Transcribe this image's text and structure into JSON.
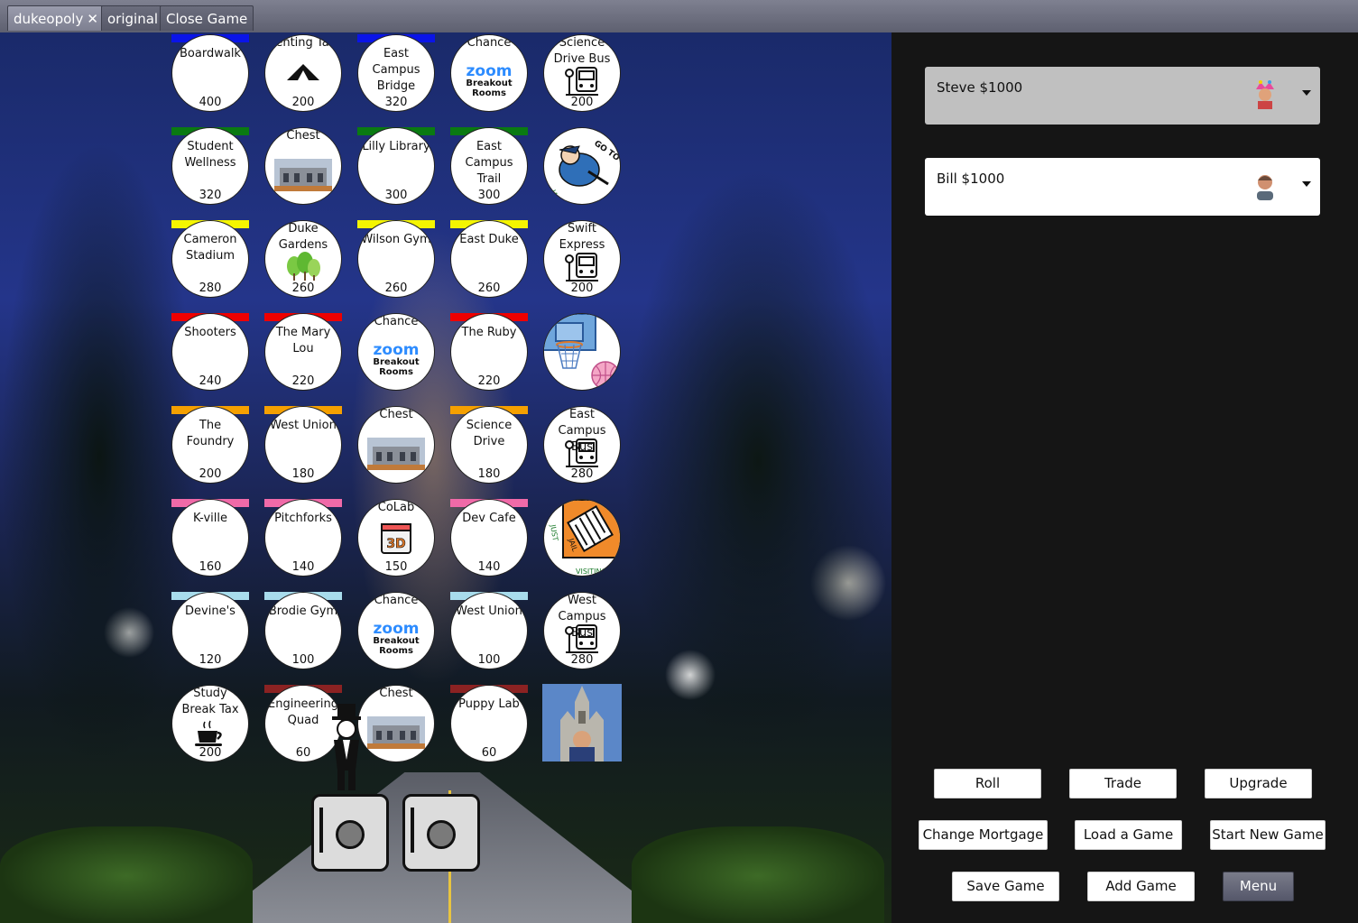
{
  "tabs": [
    {
      "label": "dukeopoly",
      "close": "✕"
    },
    {
      "label": "original"
    },
    {
      "label": "Close Game"
    }
  ],
  "board": {
    "row1": [
      {
        "name": "Boardwalk",
        "price": "400",
        "color": "#0a14e8"
      },
      {
        "name": "Tenting Tax",
        "price": "200",
        "icon": "tent-icon"
      },
      {
        "name": "East Campus Bridge",
        "price": "320",
        "color": "#0a14e8"
      },
      {
        "name": "Chance",
        "logo": "Zoom Breakout Rooms",
        "zoom1": "zoom",
        "zoom2": "Breakout",
        "zoom3": "Rooms"
      },
      {
        "name": "Science Drive Bus",
        "price": "200",
        "icon": "bus-stop-icon"
      }
    ],
    "row2": [
      {
        "name": "Student Wellness",
        "price": "320",
        "color": "#0a7a12"
      },
      {
        "name": "Chest",
        "icon": "building-photo-icon"
      },
      {
        "name": "Lilly Library",
        "price": "300",
        "color": "#0a7a12"
      },
      {
        "name": "East Campus Trail",
        "price": "300",
        "color": "#0a7a12"
      },
      {
        "name": "Go To Jail",
        "icon": "go-to-jail-icon",
        "caption1": "GO TO",
        "caption2": "JAIL"
      }
    ],
    "row3": [
      {
        "name": "Cameron Stadium",
        "price": "280",
        "color": "#f5f500"
      },
      {
        "name": "Duke Gardens",
        "price": "260",
        "icon": "trees-icon"
      },
      {
        "name": "Wilson Gym",
        "price": "260",
        "color": "#f5f500"
      },
      {
        "name": "East Duke",
        "price": "260",
        "color": "#f5f500"
      },
      {
        "name": "Swift Express",
        "price": "200",
        "icon": "bus-stop-icon"
      }
    ],
    "row4": [
      {
        "name": "Shooters",
        "price": "240",
        "color": "#ee0000"
      },
      {
        "name": "The Mary Lou",
        "price": "220",
        "color": "#ee0000"
      },
      {
        "name": "Chance",
        "zoom1": "zoom",
        "zoom2": "Breakout",
        "zoom3": "Rooms"
      },
      {
        "name": "The Ruby",
        "price": "220",
        "color": "#ee0000"
      },
      {
        "name": "Free Parking",
        "icon": "basketball-hoop-icon"
      }
    ],
    "row5": [
      {
        "name": "The Foundry",
        "price": "200",
        "color": "#f5a000"
      },
      {
        "name": "West Union",
        "price": "180",
        "color": "#f5a000"
      },
      {
        "name": "Chest",
        "icon": "building-photo-icon"
      },
      {
        "name": "Science Drive",
        "price": "180",
        "color": "#f5a000"
      },
      {
        "name": "East Campus Bus",
        "price": "280",
        "icon": "bus-stop-icon"
      }
    ],
    "row6": [
      {
        "name": "K-ville",
        "price": "160",
        "color": "#f06aa8"
      },
      {
        "name": "Pitchforks",
        "price": "140",
        "color": "#f06aa8"
      },
      {
        "name": "CoLab",
        "price": "150",
        "icon": "3d-printer-icon",
        "label3d": "3D"
      },
      {
        "name": "Dev Cafe",
        "price": "140",
        "color": "#f06aa8"
      },
      {
        "name": "Just Visiting",
        "icon": "jail-icon",
        "caption1": "JUST",
        "caption2": "VISITING",
        "caption3": "IN",
        "caption4": "JAIL"
      }
    ],
    "row7": [
      {
        "name": "Devine's",
        "price": "120",
        "color": "#a8dcec"
      },
      {
        "name": "Brodie Gym",
        "price": "100",
        "color": "#a8dcec"
      },
      {
        "name": "Chance",
        "zoom1": "zoom",
        "zoom2": "Breakout",
        "zoom3": "Rooms"
      },
      {
        "name": "West Union",
        "price": "100",
        "color": "#a8dcec"
      },
      {
        "name": "West Campus Bus",
        "price": "280",
        "icon": "bus-stop-icon"
      }
    ],
    "row8": [
      {
        "name": "Study Break Tax",
        "price": "200",
        "icon": "coffee-cup-icon"
      },
      {
        "name": "Engineering Quad",
        "price": "60",
        "color": "#8b2222"
      },
      {
        "name": "Chest",
        "icon": "building-photo-icon"
      },
      {
        "name": "Puppy Lab",
        "price": "60",
        "color": "#8b2222"
      },
      {
        "name": "Go",
        "icon": "chapel-photo-icon"
      }
    ]
  },
  "dice": [
    {
      "value": 1,
      "icon": "die-icon"
    },
    {
      "value": 1,
      "icon": "die-icon"
    }
  ],
  "players": [
    {
      "label": "Steve $1000",
      "background": "#c0c0c0",
      "avatar": "jester-avatar-icon"
    },
    {
      "label": "Bill $1000",
      "background": "#ffffff",
      "avatar": "person-avatar-icon"
    }
  ],
  "controls": {
    "roll": "Roll",
    "trade": "Trade",
    "upgrade": "Upgrade",
    "change_mortgage": "Change Mortgage",
    "load_game": "Load a Game",
    "start_new_game": "Start New Game",
    "save_game": "Save Game",
    "add_game": "Add Game",
    "menu": "Menu"
  }
}
